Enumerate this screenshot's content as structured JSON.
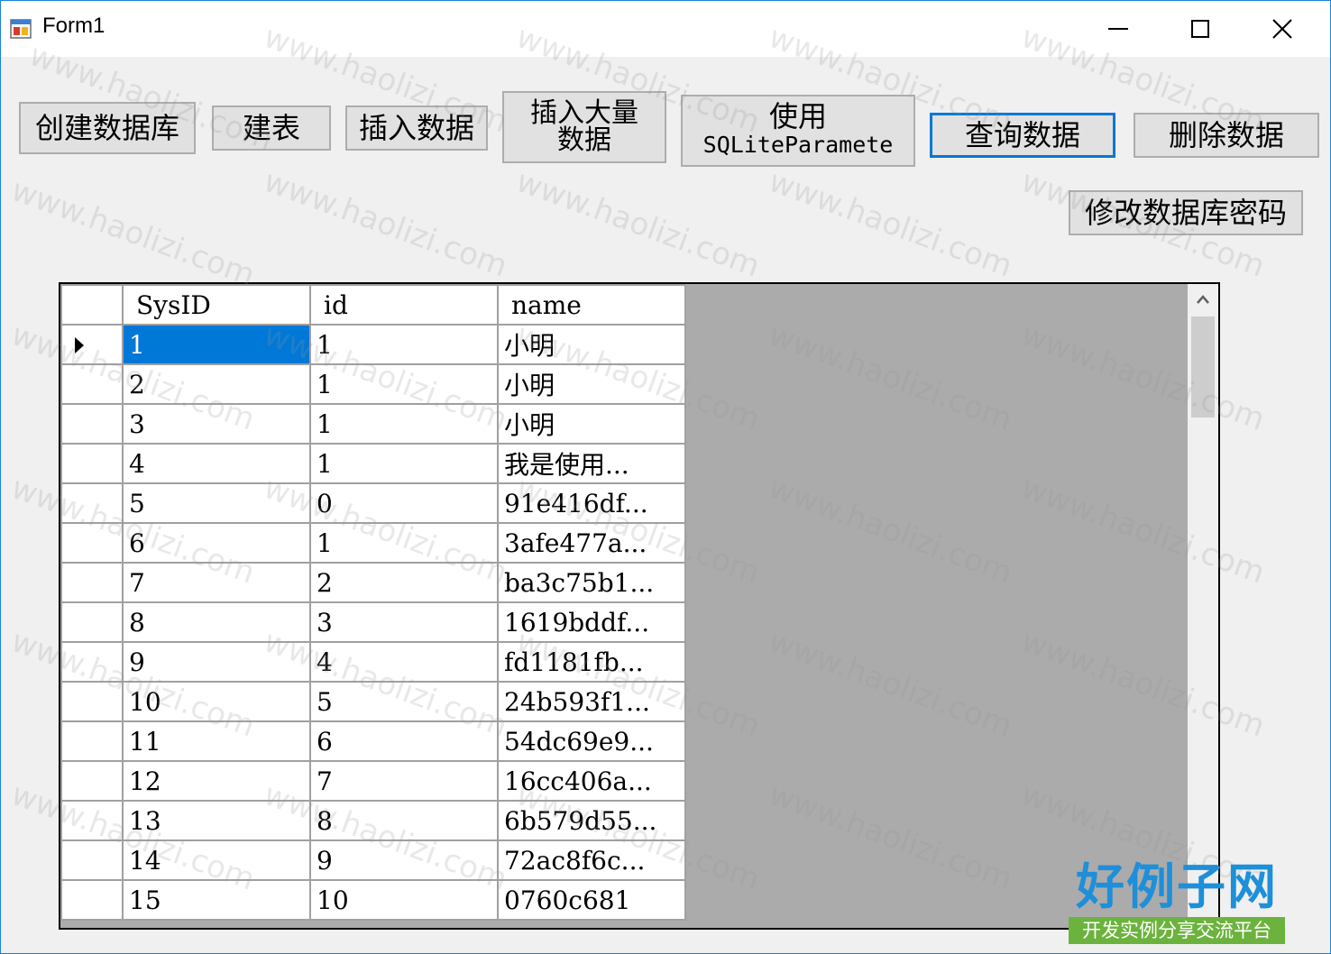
{
  "window": {
    "title": "Form1"
  },
  "toolbar": {
    "create_db": "创建数据库",
    "create_table": "建表",
    "insert_data": "插入数据",
    "bulk_insert": "插入大量\n数据",
    "use_param_line1": "使用",
    "use_param_line2": "SQLiteParamete",
    "query_data": "查询数据",
    "delete_data": "删除数据",
    "change_password": "修改数据库密码"
  },
  "grid": {
    "columns": [
      "SysID",
      "id",
      "name"
    ],
    "rows": [
      [
        "1",
        "1",
        "小明"
      ],
      [
        "2",
        "1",
        "小明"
      ],
      [
        "3",
        "1",
        "小明"
      ],
      [
        "4",
        "1",
        "我是使用..."
      ],
      [
        "5",
        "0",
        "91e416df..."
      ],
      [
        "6",
        "1",
        "3afe477a..."
      ],
      [
        "7",
        "2",
        "ba3c75b1..."
      ],
      [
        "8",
        "3",
        "1619bddf..."
      ],
      [
        "9",
        "4",
        "fd1181fb..."
      ],
      [
        "10",
        "5",
        "24b593f1..."
      ],
      [
        "11",
        "6",
        "54dc69e9..."
      ],
      [
        "12",
        "7",
        "16cc406a..."
      ],
      [
        "13",
        "8",
        "6b579d55..."
      ],
      [
        "14",
        "9",
        "72ac8f6c..."
      ],
      [
        "15",
        "10",
        "0760c681"
      ]
    ],
    "selected_row": 0
  },
  "watermark": {
    "text": "www.haolizi.com"
  },
  "logo": {
    "main": "好例子网",
    "sub": "开发实例分享交流平台"
  },
  "colors": {
    "selection": "#0078d7",
    "grid_background": "#ababab",
    "logo_blue": "#1e8fd8",
    "logo_green": "#6cb33e"
  }
}
